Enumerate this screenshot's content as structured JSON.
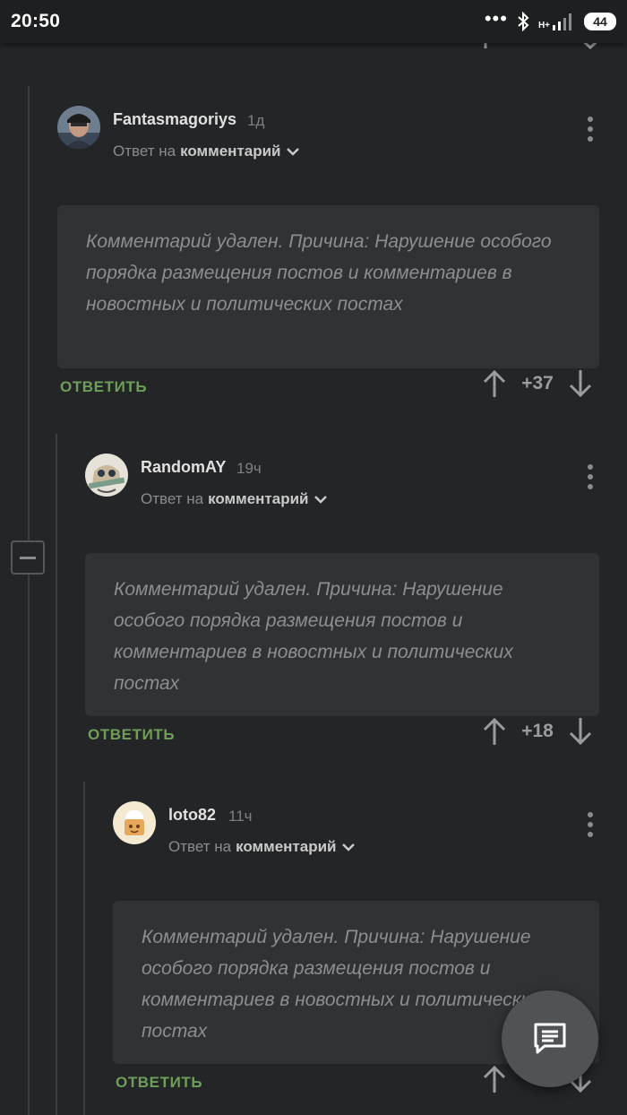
{
  "status_bar": {
    "time": "20:50",
    "network": "H+",
    "battery": "44"
  },
  "comments": [
    {
      "author": "Fantasmagoriys",
      "time": "1д",
      "reply_prefix": "Ответ на",
      "reply_target": "комментарий",
      "content": "Комментарий удален. Причина: Нарушение особого порядка размещения постов и комментариев в новостных и политических постах",
      "reply_label": "ОТВЕТИТЬ",
      "votes": "+37"
    },
    {
      "author": "RandomAY",
      "time": "19ч",
      "reply_prefix": "Ответ на",
      "reply_target": "комментарий",
      "content": "Комментарий удален. Причина: Нарушение особого порядка размещения постов и комментариев в новостных и политических постах",
      "reply_label": "ОТВЕТИТЬ",
      "votes": "+18"
    },
    {
      "author": "loto82",
      "time": "11ч",
      "reply_prefix": "Ответ на",
      "reply_target": "комментарий",
      "content": "Комментарий удален. Причина: Нарушение особого порядка размещения постов и комментариев в новостных и политических постах",
      "reply_label": "ОТВЕТИТЬ",
      "votes": ""
    }
  ],
  "colors": {
    "background": "#232527",
    "card": "#303235",
    "reply_green": "#6e9e5a",
    "muted_text": "#8c8f92"
  }
}
